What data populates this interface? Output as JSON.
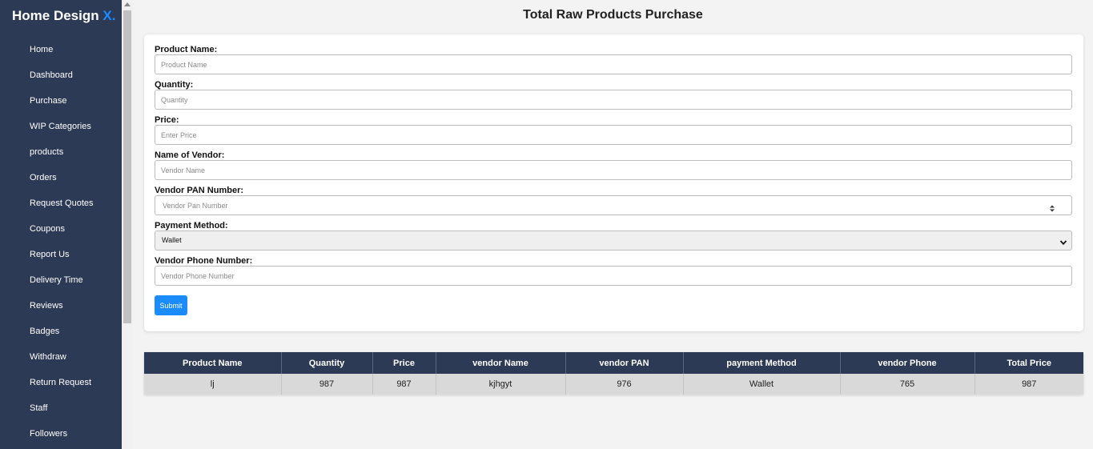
{
  "sidebar": {
    "brand": "Home Design",
    "brand_accent": "X.",
    "items": [
      {
        "label": "Home"
      },
      {
        "label": "Dashboard"
      },
      {
        "label": "Purchase"
      },
      {
        "label": "WIP Categories"
      },
      {
        "label": "products"
      },
      {
        "label": "Orders"
      },
      {
        "label": "Request Quotes"
      },
      {
        "label": "Coupons"
      },
      {
        "label": "Report Us"
      },
      {
        "label": "Delivery Time"
      },
      {
        "label": "Reviews"
      },
      {
        "label": "Badges"
      },
      {
        "label": "Withdraw"
      },
      {
        "label": "Return Request"
      },
      {
        "label": "Staff"
      },
      {
        "label": "Followers"
      }
    ]
  },
  "page": {
    "title": "Total Raw Products Purchase"
  },
  "form": {
    "product_name": {
      "label": "Product Name:",
      "placeholder": "Product Name",
      "value": ""
    },
    "quantity": {
      "label": "Quantity:",
      "placeholder": "Quantity",
      "value": ""
    },
    "price": {
      "label": "Price:",
      "placeholder": "Enter Price",
      "value": ""
    },
    "vendor_name": {
      "label": "Name of Vendor:",
      "placeholder": "Vendor Name",
      "value": ""
    },
    "vendor_pan": {
      "label": "Vendor PAN Number:",
      "placeholder": "Vendor Pan Number",
      "value": ""
    },
    "payment_method": {
      "label": "Payment Method:",
      "selected": "Wallet"
    },
    "vendor_phone": {
      "label": "Vendor Phone Number:",
      "placeholder": "Vendor Phone Number",
      "value": ""
    },
    "submit_label": "Submit"
  },
  "table": {
    "headers": [
      "Product Name",
      "Quantity",
      "Price",
      "vendor Name",
      "vendor PAN",
      "payment Method",
      "vendor Phone",
      "Total Price"
    ],
    "rows": [
      [
        "lj",
        "987",
        "987",
        "kjhgyt",
        "976",
        "Wallet",
        "765",
        "987"
      ]
    ]
  },
  "colors": {
    "sidebar_bg": "#2c3a55",
    "accent": "#1a8cff",
    "page_bg": "#f3f3f3"
  }
}
